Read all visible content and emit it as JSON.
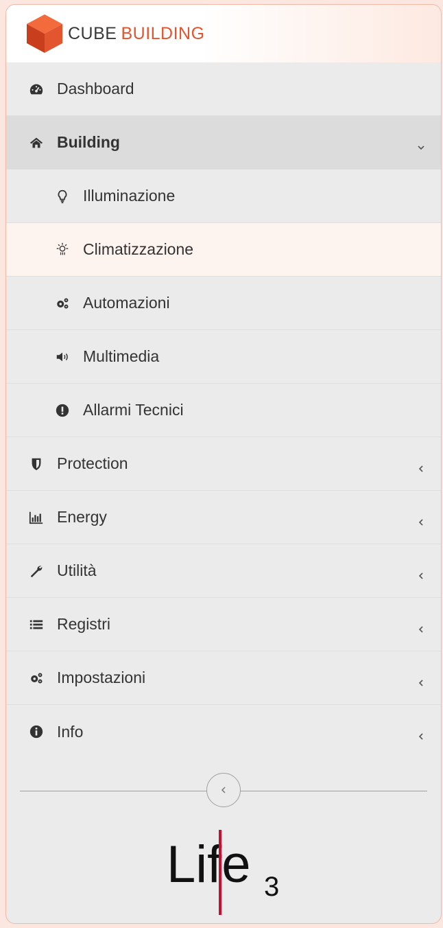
{
  "brand": {
    "word1": "CUBE",
    "word2": "BUILDING",
    "accent": "#e2552f"
  },
  "menu": {
    "dashboard": {
      "label": "Dashboard",
      "icon": "dashboard-icon"
    },
    "building": {
      "label": "Building",
      "icon": "home-icon",
      "expanded": true,
      "children": [
        {
          "label": "Illuminazione",
          "icon": "lightbulb-icon"
        },
        {
          "label": "Climatizzazione",
          "icon": "climate-icon",
          "selected": true
        },
        {
          "label": "Automazioni",
          "icon": "gears-icon"
        },
        {
          "label": "Multimedia",
          "icon": "speaker-icon"
        },
        {
          "label": "Allarmi Tecnici",
          "icon": "alert-icon"
        }
      ]
    },
    "protection": {
      "label": "Protection",
      "icon": "shield-icon"
    },
    "energy": {
      "label": "Energy",
      "icon": "bar-chart-icon"
    },
    "utilita": {
      "label": "Utilità",
      "icon": "wrench-icon"
    },
    "registri": {
      "label": "Registri",
      "icon": "list-icon"
    },
    "impostazioni": {
      "label": "Impostazioni",
      "icon": "gears-icon"
    },
    "info": {
      "label": "Info",
      "icon": "info-icon"
    }
  },
  "footer": {
    "logo": {
      "main": "Life",
      "sub": "3"
    }
  }
}
